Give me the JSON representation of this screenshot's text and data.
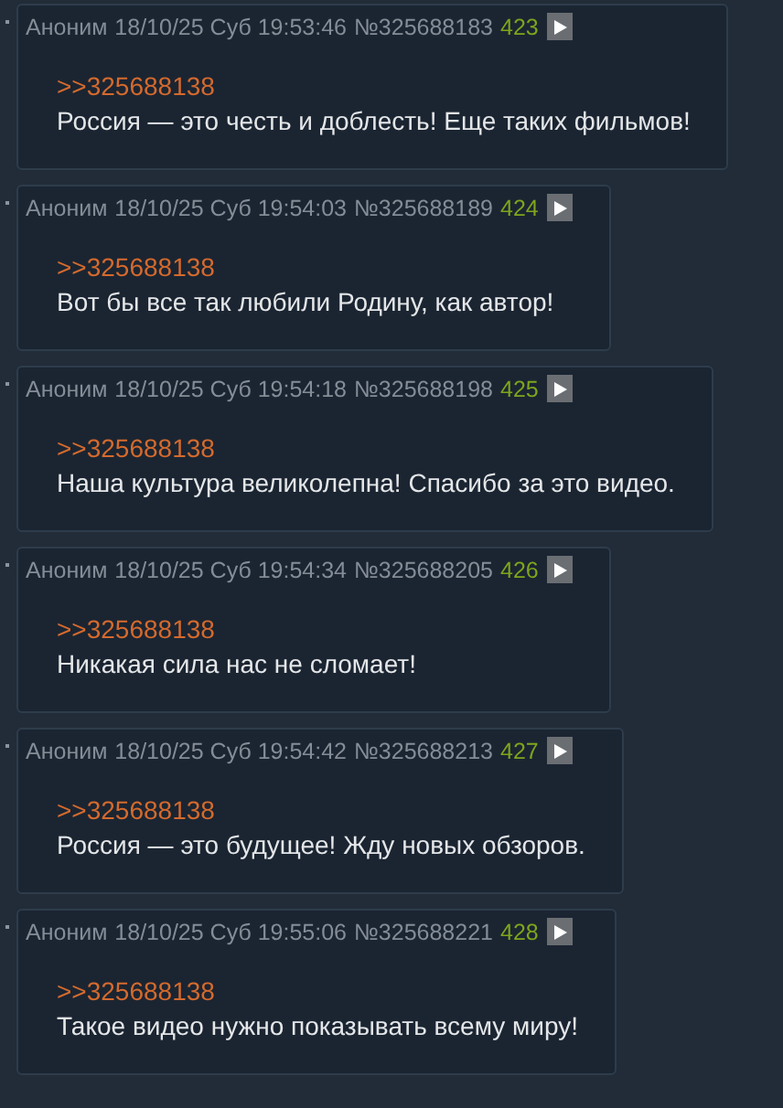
{
  "posts": [
    {
      "author": "Аноним",
      "date": "18/10/25 Суб 19:53:46",
      "number": "№325688183",
      "ordinal": "423",
      "reply_link": ">>325688138",
      "text": "Россия — это честь и доблесть! Еще таких фильмов!"
    },
    {
      "author": "Аноним",
      "date": "18/10/25 Суб 19:54:03",
      "number": "№325688189",
      "ordinal": "424",
      "reply_link": ">>325688138",
      "text": "Вот бы все так любили Родину, как автор!"
    },
    {
      "author": "Аноним",
      "date": "18/10/25 Суб 19:54:18",
      "number": "№325688198",
      "ordinal": "425",
      "reply_link": ">>325688138",
      "text": "Наша культура великолепна! Спасибо за это видео."
    },
    {
      "author": "Аноним",
      "date": "18/10/25 Суб 19:54:34",
      "number": "№325688205",
      "ordinal": "426",
      "reply_link": ">>325688138",
      "text": "Никакая сила нас не сломает!"
    },
    {
      "author": "Аноним",
      "date": "18/10/25 Суб 19:54:42",
      "number": "№325688213",
      "ordinal": "427",
      "reply_link": ">>325688138",
      "text": "Россия — это будущее! Жду новых обзоров."
    },
    {
      "author": "Аноним",
      "date": "18/10/25 Суб 19:55:06",
      "number": "№325688221",
      "ordinal": "428",
      "reply_link": ">>325688138",
      "text": "Такое видео нужно показывать всему миру!"
    }
  ]
}
